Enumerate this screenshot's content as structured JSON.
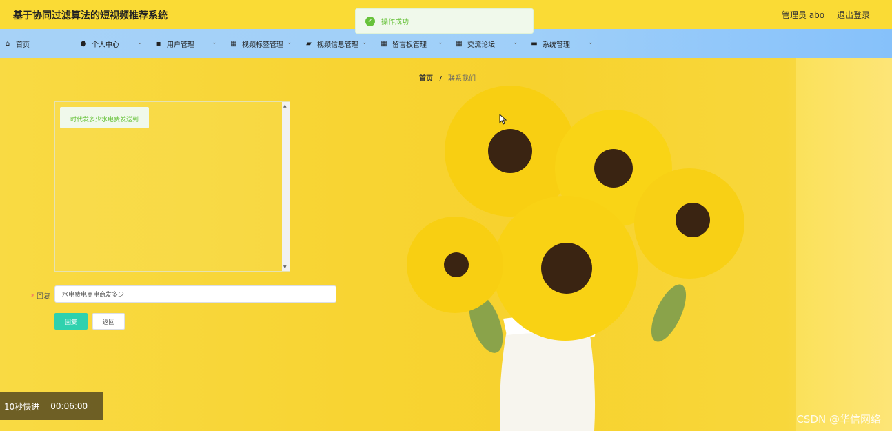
{
  "header": {
    "title": "基于协同过滤算法的短视频推荐系统",
    "user": "管理员 abo",
    "logout": "退出登录"
  },
  "toast": {
    "message": "操作成功"
  },
  "nav": [
    {
      "label": "首页",
      "icon": "home-icon",
      "dropdown": false
    },
    {
      "label": "个人中心",
      "icon": "user-icon",
      "dropdown": true
    },
    {
      "label": "用户管理",
      "icon": "chat-icon",
      "dropdown": true
    },
    {
      "label": "视频标签管理",
      "icon": "grid-icon",
      "dropdown": true
    },
    {
      "label": "视频信息管理",
      "icon": "folder-icon",
      "dropdown": true
    },
    {
      "label": "留言板管理",
      "icon": "grid-icon",
      "dropdown": true
    },
    {
      "label": "交流论坛",
      "icon": "grid-icon",
      "dropdown": true
    },
    {
      "label": "系统管理",
      "icon": "monitor-icon",
      "dropdown": true
    }
  ],
  "breadcrumb": {
    "home": "首页",
    "separator": "/",
    "current": "联系我们"
  },
  "messages": [
    {
      "text": "时代发多少水电费发送到"
    }
  ],
  "form": {
    "reply_label": "回复",
    "reply_value": "水电费电商电商发多少",
    "reply_button": "回复",
    "back_button": "返回"
  },
  "video": {
    "skip_label": "10秒快进",
    "time": "00:06:00"
  },
  "watermark": "CSDN @华信网络",
  "colors": {
    "header": "#fadb35",
    "nav": "#a7d2f7",
    "accent": "#2fd1ae",
    "success": "#67c23a"
  }
}
